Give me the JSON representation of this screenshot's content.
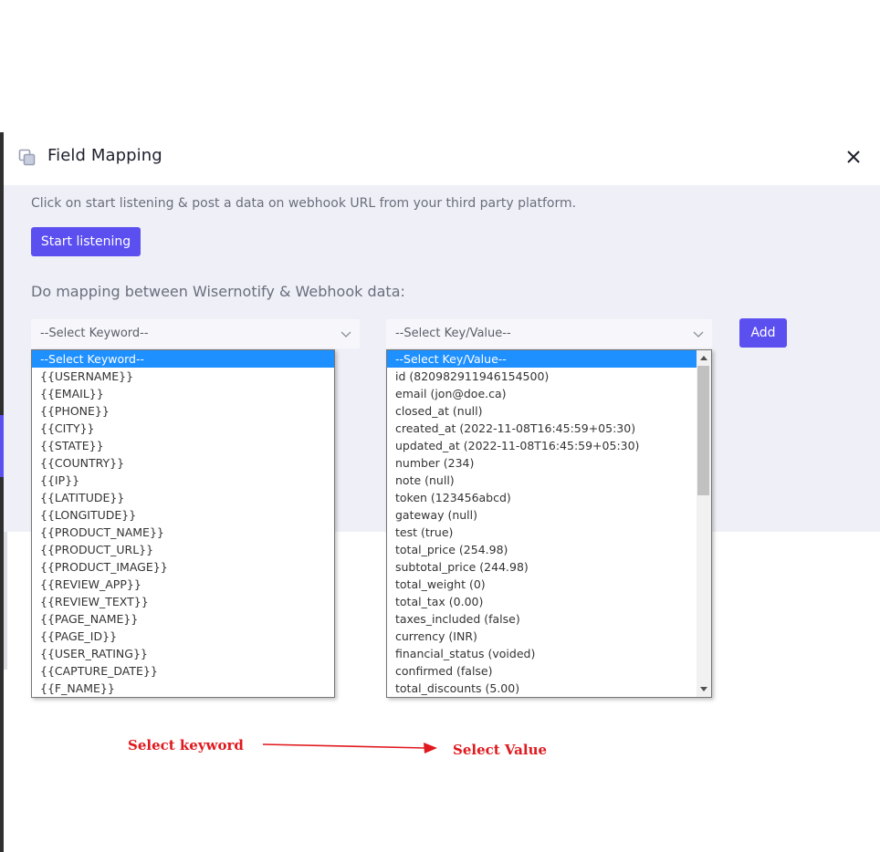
{
  "modal": {
    "title": "Field Mapping",
    "instruction": "Click on start listening & post a data on webhook URL from your third party platform.",
    "start_button": "Start listening",
    "mapping_heading": "Do mapping between Wisernotify & Webhook data:",
    "add_button": "Add"
  },
  "keyword_select": {
    "value": "--Select Keyword--",
    "options": [
      "--Select Keyword--",
      "{{USERNAME}}",
      "{{EMAIL}}",
      "{{PHONE}}",
      "{{CITY}}",
      "{{STATE}}",
      "{{COUNTRY}}",
      "{{IP}}",
      "{{LATITUDE}}",
      "{{LONGITUDE}}",
      "{{PRODUCT_NAME}}",
      "{{PRODUCT_URL}}",
      "{{PRODUCT_IMAGE}}",
      "{{REVIEW_APP}}",
      "{{REVIEW_TEXT}}",
      "{{PAGE_NAME}}",
      "{{PAGE_ID}}",
      "{{USER_RATING}}",
      "{{CAPTURE_DATE}}",
      "{{F_NAME}}"
    ]
  },
  "value_select": {
    "value": "--Select Key/Value--",
    "options": [
      "--Select Key/Value--",
      "id (820982911946154500)",
      "email (jon@doe.ca)",
      "closed_at (null)",
      "created_at (2022-11-08T16:45:59+05:30)",
      "updated_at (2022-11-08T16:45:59+05:30)",
      "number (234)",
      "note (null)",
      "token (123456abcd)",
      "gateway (null)",
      "test (true)",
      "total_price (254.98)",
      "subtotal_price (244.98)",
      "total_weight (0)",
      "total_tax (0.00)",
      "taxes_included (false)",
      "currency (INR)",
      "financial_status (voided)",
      "confirmed (false)",
      "total_discounts (5.00)"
    ]
  },
  "annotations": {
    "left": "Select keyword",
    "right": "Select Value",
    "color": "#e0191e"
  },
  "colors": {
    "accent": "#5b4ff0",
    "highlight": "#1e90ff",
    "body_bg": "#eff0f7"
  },
  "icons": {
    "header": "copy-squares-icon",
    "close": "close-icon",
    "select_caret": "chevron-down-icon"
  }
}
